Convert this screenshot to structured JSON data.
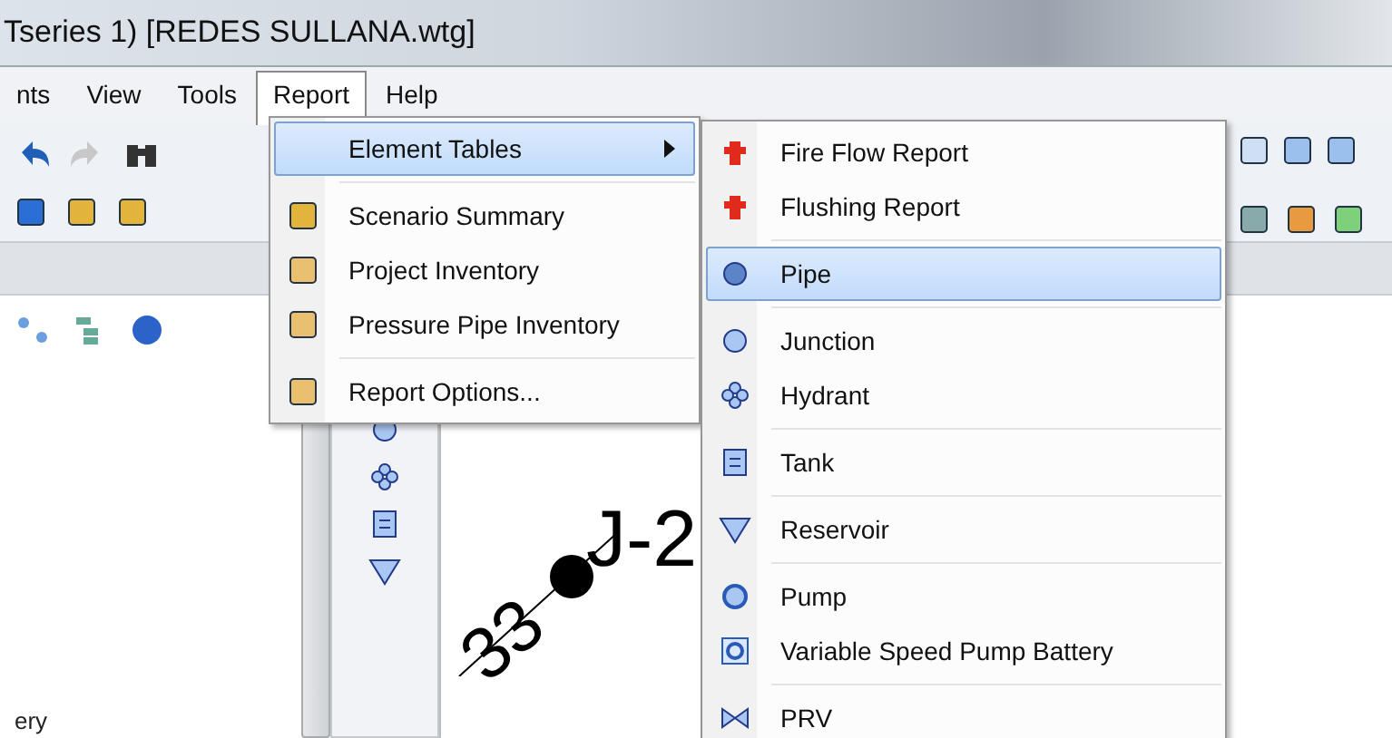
{
  "window": {
    "title": "Tseries 1) [REDES SULLANA.wtg]"
  },
  "menubar": [
    {
      "label": "nts",
      "selected": false
    },
    {
      "label": "View",
      "selected": false
    },
    {
      "label": "Tools",
      "selected": false
    },
    {
      "label": "Report",
      "selected": true
    },
    {
      "label": "Help",
      "selected": false
    }
  ],
  "report_menu": [
    {
      "label": "Element Tables",
      "kind": "submenu",
      "selected": true,
      "separator_before": false
    },
    {
      "label": "Scenario Summary",
      "kind": "item",
      "selected": false,
      "separator_before": true
    },
    {
      "label": "Project Inventory",
      "kind": "item",
      "selected": false,
      "separator_before": false
    },
    {
      "label": "Pressure Pipe Inventory",
      "kind": "item",
      "selected": false,
      "separator_before": false
    },
    {
      "label": "Report Options...",
      "kind": "item",
      "selected": false,
      "separator_before": true
    }
  ],
  "element_tables_menu": [
    {
      "label": "Fire Flow Report",
      "selected": false,
      "separator_before": false
    },
    {
      "label": "Flushing Report",
      "selected": false,
      "separator_before": false
    },
    {
      "label": "Pipe",
      "selected": true,
      "separator_before": true
    },
    {
      "label": "Junction",
      "selected": false,
      "separator_before": true
    },
    {
      "label": "Hydrant",
      "selected": false,
      "separator_before": false
    },
    {
      "label": "Tank",
      "selected": false,
      "separator_before": true
    },
    {
      "label": "Reservoir",
      "selected": false,
      "separator_before": true
    },
    {
      "label": "Pump",
      "selected": false,
      "separator_before": true
    },
    {
      "label": "Variable Speed Pump Battery",
      "selected": false,
      "separator_before": false
    },
    {
      "label": "PRV",
      "selected": false,
      "separator_before": true
    }
  ],
  "left_pane": {
    "text": "ery"
  },
  "canvas": {
    "node_label": "J-2",
    "pipe_label": "33"
  }
}
